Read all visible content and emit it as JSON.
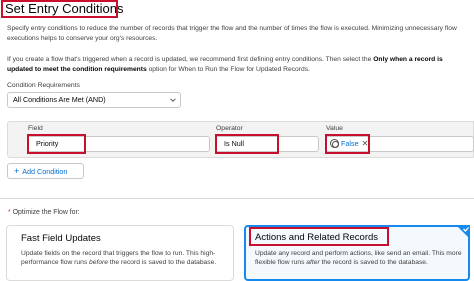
{
  "section": {
    "title": "Set Entry Conditions",
    "description": "Specify entry conditions to reduce the number of records that trigger the flow and the number of times the flow is executed. Minimizing unnecessary flow executions helps to conserve your org's resources.",
    "recommend_pre": "If you create a flow that's triggered when a record is updated, we recommend first defining entry conditions. Then select the ",
    "recommend_bold": "Only when a record is updated to meet the condition requirements",
    "recommend_post": " option for When to Run the Flow for Updated Records."
  },
  "condition_requirements": {
    "label": "Condition Requirements",
    "selected": "All Conditions Are Met (AND)",
    "icon": "chevron-down-icon"
  },
  "condition_row": {
    "field_label": "Field",
    "field_value": "Priority",
    "operator_label": "Operator",
    "operator_value": "Is Null",
    "value_label": "Value",
    "value_pill": "False",
    "value_icon": "boolean-icon",
    "remove_icon": "close-icon"
  },
  "add_condition": {
    "label": "Add Condition",
    "icon": "plus-icon"
  },
  "optimize": {
    "required_marker": "*",
    "label": "Optimize the Flow for:",
    "options": [
      {
        "title": "Fast Field Updates",
        "body_1": "Update fields on the record that triggers the flow to run. This high-performance flow runs ",
        "body_em": "before",
        "body_2": " the record is saved to the database.",
        "selected": false
      },
      {
        "title": "Actions and Related Records",
        "body_1": "Update any record and perform actions, like send an email. This more flexible flow runs ",
        "body_em": "after",
        "body_2": " the record is saved to the database.",
        "selected": true
      }
    ]
  },
  "colors": {
    "highlight": "#c8102e",
    "brand_blue": "#0070d2",
    "selected_border": "#1589ee"
  }
}
